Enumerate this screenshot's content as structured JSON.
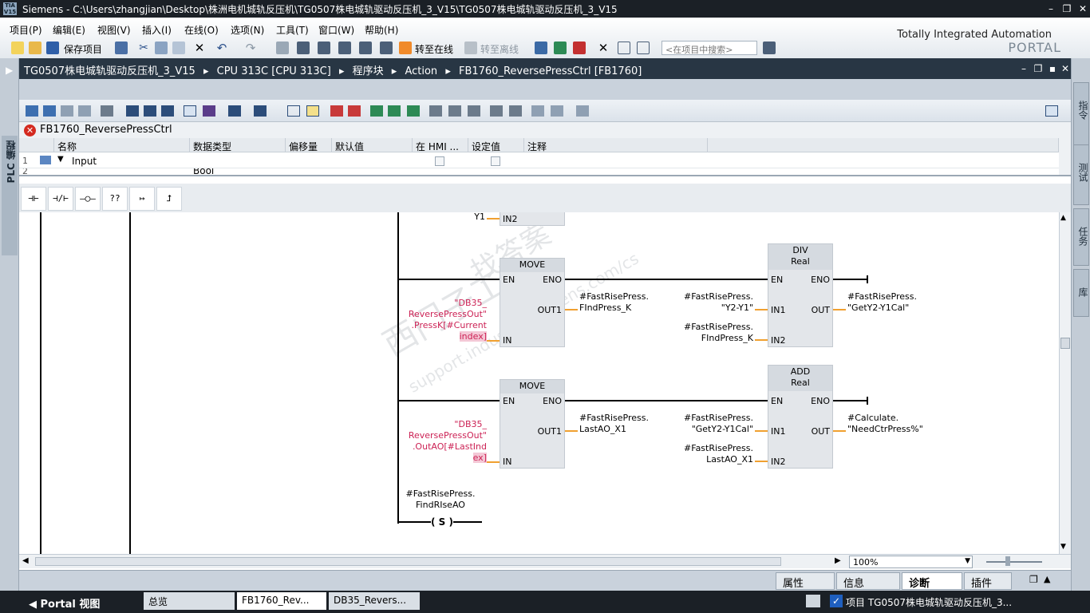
{
  "window": {
    "logo_text": "TIA V15",
    "title": "Siemens  -  C:\\Users\\zhangjian\\Desktop\\株洲电机城轨反压机\\TG0507株电城轨驱动反压机_3_V15\\TG0507株电城轨驱动反压机_3_V15"
  },
  "menu": [
    "项目(P)",
    "编辑(E)",
    "视图(V)",
    "插入(I)",
    "在线(O)",
    "选项(N)",
    "工具(T)",
    "窗口(W)",
    "帮助(H)"
  ],
  "toolbar": {
    "save_label": "保存项目",
    "go_online": "转至在线",
    "go_offline": "转至离线",
    "search_placeholder": "<在项目中搜索>"
  },
  "brand": {
    "line1": "Totally Integrated Automation",
    "line2": "PORTAL"
  },
  "left_tab": "PLC 编程",
  "breadcrumb": {
    "path": [
      "TG0507株电城轨驱动反压机_3_V15",
      "CPU 313C [CPU 313C]",
      "程序块",
      "Action",
      "FB1760_ReversePressCtrl [FB1760]"
    ]
  },
  "block": {
    "name": "FB1760_ReversePressCtrl"
  },
  "interface": {
    "headers": [
      "名称",
      "数据类型",
      "偏移量",
      "默认值",
      "在 HMI ...",
      "设定值",
      "注释"
    ],
    "rows": [
      {
        "num": "1",
        "name": "Input"
      }
    ],
    "row2_num": "2",
    "row2_type": "Bool"
  },
  "ladder_toolbar": [
    "⊣⊢",
    "⊣/⊢",
    "–◯–",
    "??",
    "↦",
    "⮥"
  ],
  "network": {
    "top_var": "Y1",
    "top_pin": "IN2",
    "move1": {
      "title": "MOVE",
      "en": "EN",
      "eno": "ENO",
      "in": "IN",
      "out": "OUT1",
      "in_var": [
        "\"DB35_",
        "ReversePressOut\"",
        ".PressK[#Current",
        "index]"
      ],
      "out_var": [
        "#FastRisePress.",
        "FIndPress_K"
      ]
    },
    "div": {
      "title": "DIV",
      "type": "Real",
      "en": "EN",
      "eno": "ENO",
      "in1": "IN1",
      "in2": "IN2",
      "out": "OUT",
      "in1_var": [
        "#FastRisePress.",
        "\"Y2-Y1\""
      ],
      "in2_var": [
        "#FastRisePress.",
        "FIndPress_K"
      ],
      "out_var": [
        "#FastRisePress.",
        "\"GetY2-Y1Cal\""
      ]
    },
    "move2": {
      "title": "MOVE",
      "en": "EN",
      "eno": "ENO",
      "in": "IN",
      "out": "OUT1",
      "in_var": [
        "\"DB35_",
        "ReversePressOut\"",
        ".OutAO[#LastInd",
        "ex]"
      ],
      "out_var": [
        "#FastRisePress.",
        "LastAO_X1"
      ]
    },
    "add": {
      "title": "ADD",
      "type": "Real",
      "en": "EN",
      "eno": "ENO",
      "in1": "IN1",
      "in2": "IN2",
      "out": "OUT",
      "in1_var": [
        "#FastRisePress.",
        "\"GetY2-Y1Cal\""
      ],
      "in2_var": [
        "#FastRisePress.",
        "LastAO_X1"
      ],
      "out_var": [
        "#Calculate.",
        "\"NeedCtrPress%\""
      ]
    },
    "coil": {
      "var": [
        "#FastRisePress.",
        "FindRIseAO"
      ],
      "symbol": "S"
    }
  },
  "watermark": {
    "line1": "西门子工业",
    "line2": "找答案",
    "line3": "support.industry.siemens.com/cs"
  },
  "zoom": "100%",
  "right_tabs": [
    "指令",
    "测试",
    "任务",
    "库"
  ],
  "inspector": {
    "props": "属性",
    "info": "信息",
    "diag": "诊断",
    "plugins": "插件"
  },
  "taskbar": {
    "portal": "Portal 视图",
    "overview": "总览",
    "tab_fb": "FB1760_Rev...",
    "tab_db": "DB35_Revers...",
    "status": "项目 TG0507株电城轨驱动反压机_3..."
  },
  "colors": {
    "titlebar": "#1b2026",
    "breadcrumb": "#283644",
    "var_highlight": "#cc2255",
    "wire_input": "#f0a030"
  }
}
